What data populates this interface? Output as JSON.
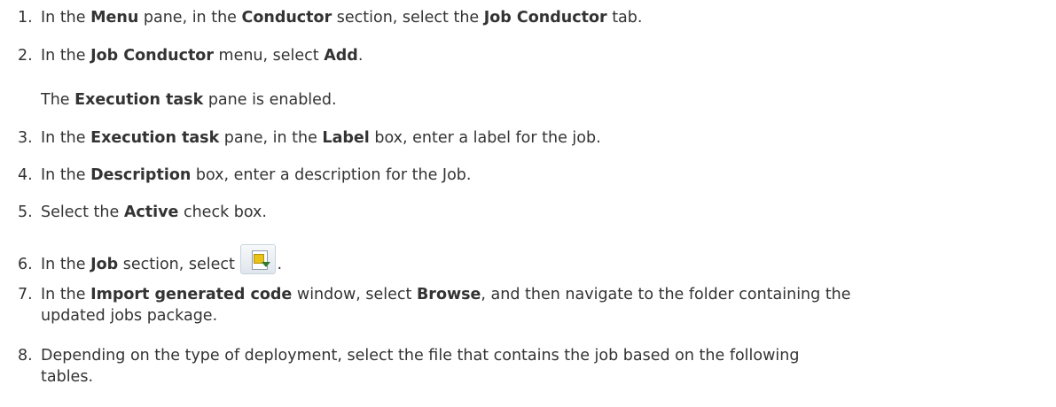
{
  "steps": [
    {
      "num": "1.",
      "t1": "In the ",
      "b1": "Menu",
      "t2": " pane, in the ",
      "b2": "Conductor",
      "t3": " section, select the ",
      "b3": "Job Conductor",
      "t4": " tab."
    },
    {
      "num": "2.",
      "t1": "In the ",
      "b1": "Job Conductor",
      "t2": " menu, select ",
      "b2": "Add",
      "t3": "."
    },
    {
      "num": "3.",
      "t1": "In the ",
      "b1": "Execution task",
      "t2": " pane, in the ",
      "b2": "Label",
      "t3": " box, enter a label for the job."
    },
    {
      "num": "4.",
      "t1": "In the ",
      "b1": "Description",
      "t2": " box, enter a description for the Job."
    },
    {
      "num": "5.",
      "t1": "Select the ",
      "b1": "Active",
      "t2": " check box."
    },
    {
      "num": "6.",
      "t1": "In the ",
      "b1": "Job",
      "t2": " section, select ",
      "t3": "."
    },
    {
      "num": "7.",
      "t1": "In the ",
      "b1": "Import generated code",
      "t2": " window, select ",
      "b2": "Browse",
      "t3": ", and then navigate to the folder containing the",
      "t4": "updated jobs package."
    },
    {
      "num": "8.",
      "t1": "Depending on the type of deployment, select the file that contains the job based on the following",
      "t2": "tables."
    }
  ],
  "note_after_step2": {
    "b1": "Execution task",
    "t1": " pane is enabled.",
    "t0": "The "
  },
  "icons": {
    "import_icon": "import-code-icon"
  }
}
